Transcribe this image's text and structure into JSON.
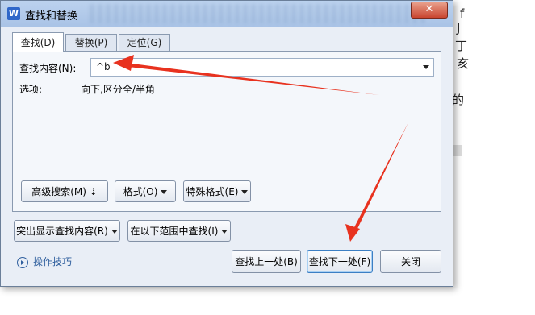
{
  "window": {
    "title": "查找和替换",
    "app_icon_letter": "W",
    "close_glyph": "✕"
  },
  "tabs": [
    {
      "label": "查找(D)",
      "active": true
    },
    {
      "label": "替换(P)",
      "active": false
    },
    {
      "label": "定位(G)",
      "active": false
    }
  ],
  "find": {
    "label": "查找内容(N):",
    "value": "^b",
    "options_label": "选项:",
    "options_value": "向下,区分全/半角"
  },
  "panel_buttons": {
    "advanced": "高级搜索(M) ⇣",
    "format": "格式(O)",
    "special": "特殊格式(E)"
  },
  "bottom_buttons": {
    "highlight": "突出显示查找内容(R)",
    "find_in": "在以下范围中查找(I)",
    "find_prev": "查找上一处(B)",
    "find_next": "查找下一处(F)",
    "close": "关闭"
  },
  "help": {
    "label": "操作技巧"
  },
  "background_chars": [
    "f",
    "J",
    "丁",
    "亥",
    "的"
  ],
  "colors": {
    "annotation_arrow": "#e8321f",
    "title_bar": "#b7cdea",
    "link": "#2f5f9e"
  }
}
